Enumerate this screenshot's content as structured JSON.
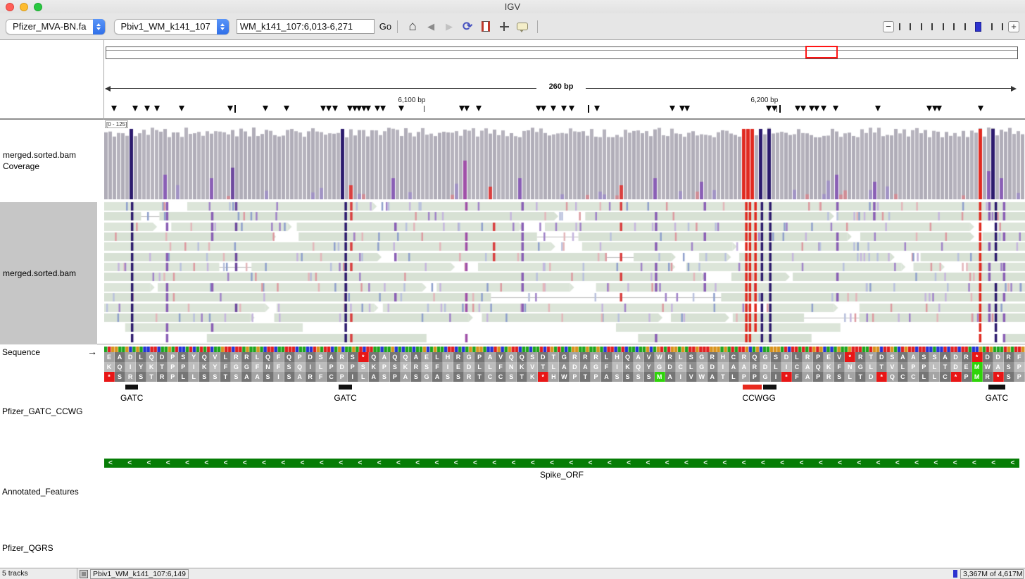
{
  "window": {
    "title": "IGV"
  },
  "toolbar": {
    "genome_select": "Pfizer_MVA-BN.fa",
    "chrom_select": "Pbiv1_WM_k141_107",
    "locus_input": "WM_k141_107:6,013-6,271",
    "go_label": "Go",
    "zoom": {
      "ticks": 10,
      "thumb_index": 7
    }
  },
  "ruler": {
    "span_label": "260 bp",
    "ticks": [
      {
        "label": "6,100 bp",
        "f": 0.334
      },
      {
        "label": "6,200 bp",
        "f": 0.717
      }
    ],
    "roi": {
      "f": 0.766,
      "w": 0.036
    },
    "markers": [
      {
        "f": 0.011
      },
      {
        "f": 0.034
      },
      {
        "f": 0.047
      },
      {
        "f": 0.057
      },
      {
        "f": 0.084
      },
      {
        "f": 0.137
      },
      {
        "f": 0.142,
        "t": "bar"
      },
      {
        "f": 0.175
      },
      {
        "f": 0.198
      },
      {
        "f": 0.238
      },
      {
        "f": 0.244
      },
      {
        "f": 0.251
      },
      {
        "f": 0.267
      },
      {
        "f": 0.272
      },
      {
        "f": 0.277
      },
      {
        "f": 0.282
      },
      {
        "f": 0.287
      },
      {
        "f": 0.297
      },
      {
        "f": 0.303
      },
      {
        "f": 0.323
      },
      {
        "f": 0.388
      },
      {
        "f": 0.394
      },
      {
        "f": 0.407
      },
      {
        "f": 0.472
      },
      {
        "f": 0.477
      },
      {
        "f": 0.488
      },
      {
        "f": 0.499
      },
      {
        "f": 0.508
      },
      {
        "f": 0.526,
        "t": "bar"
      },
      {
        "f": 0.535
      },
      {
        "f": 0.617
      },
      {
        "f": 0.628
      },
      {
        "f": 0.633
      },
      {
        "f": 0.722
      },
      {
        "f": 0.728
      },
      {
        "f": 0.734,
        "t": "bar"
      },
      {
        "f": 0.753
      },
      {
        "f": 0.759
      },
      {
        "f": 0.768
      },
      {
        "f": 0.774
      },
      {
        "f": 0.781
      },
      {
        "f": 0.794
      },
      {
        "f": 0.84
      },
      {
        "f": 0.896
      },
      {
        "f": 0.902
      },
      {
        "f": 0.907
      },
      {
        "f": 0.952
      }
    ]
  },
  "tracks": {
    "coverage": {
      "name": "merged.sorted.bam Coverage",
      "scale_label": "[0 - 125]"
    },
    "alignments": {
      "name": "merged.sorted.bam",
      "rows": 14,
      "big_gaps": [
        {
          "row": 9,
          "f": 0.42,
          "w": 0.25
        },
        {
          "row": 3,
          "f": 0.47,
          "w": 0.045
        },
        {
          "row": 6,
          "f": 0.125,
          "w": 0.035
        },
        {
          "row": 11,
          "f": 0.76,
          "w": 0.06
        },
        {
          "row": 5,
          "f": 0.545,
          "w": 0.03
        },
        {
          "row": 1,
          "f": 0.04,
          "w": 0.02
        }
      ]
    },
    "sequence": {
      "name": "Sequence",
      "strand_arrow": "→",
      "nucleotides": "ATGGAAGCAGACCTTCAAGATCCATCATATCAAGTTCTTAGAAGACTTCAATTTCAACCTGATTCAGCAAGATCTTAACAAGCACAACAAGCAGAACTTCACAGAGGACCTGCAGTTCAACAATCTGATACAGGAAGAAGACTTCATCAACAAGCAGTATGGAGATTGTTTGGGAGATATTGCAGCAAGGGATCTTATATGTGCACAGAAGTTTAATGGCTTGACTGTTCTTCCACCTCTTCTTACCGATGAAATGATTGCC",
      "frames": [
        "EADLQDPSYQVLRRLQFQPDSARS*QAQQAELHRGPAVQQSDTGRRRLHQAVWRLSGRHCRQGSDLRPEV*RTDSAASSADR*DDRF",
        "KQIYKTPPIKYFGGFNFSQILPDPSKPSKRSFIEDLLFNKVTLADAGFIKQYGDCLGDIAARDLICAQKFNGLTVLPPLTDEMWASP",
        "*SRSTRPLLSSTSAASISARFCPILASPASGASSRTCCSTK*HWPTPASSSSMAIVWATLPPGI*FAPRSLTD*QCCLLC*PMR*SP"
      ]
    },
    "gatc": {
      "name": "Pfizer_GATC_CCWG",
      "features": [
        {
          "label": "GATC",
          "f": 0.023,
          "w": 0.014,
          "segments": [
            {
              "color": "#111111",
              "frac": 1
            }
          ]
        },
        {
          "label": "GATC",
          "f": 0.2546,
          "w": 0.0146,
          "segments": [
            {
              "color": "#111111",
              "frac": 1
            }
          ]
        },
        {
          "label": "CCWGG",
          "f": 0.6935,
          "w": 0.0352,
          "segments": [
            {
              "color": "#e82a1e",
              "frac": 0.58
            },
            {
              "color": "#111111",
              "frac": 0.42
            }
          ]
        },
        {
          "label": "GATC",
          "f": 0.9602,
          "w": 0.0183,
          "segments": [
            {
              "color": "#111111",
              "frac": 1
            }
          ]
        }
      ]
    },
    "annotated": {
      "name": "Annotated_Features",
      "feature_label": "Spike_ORF",
      "color": "#067d06",
      "chevron": "<",
      "chevrons": 48
    },
    "qgrs": {
      "name": "Pfizer_QGRS"
    }
  },
  "variant_columns": [
    {
      "f": 0.029,
      "color": "#2d1b6e",
      "cov": "full",
      "density": 0.95
    },
    {
      "f": 0.067,
      "color": "#8a5fb5",
      "cov": 0.35,
      "density": 0.4
    },
    {
      "f": 0.116,
      "color": "#8a5fb5",
      "cov": 0.3,
      "density": 0.35
    },
    {
      "f": 0.142,
      "color": "#6e4a9e",
      "cov": 0.45,
      "density": 0.5
    },
    {
      "f": 0.261,
      "color": "#2d1b6e",
      "cov": "full",
      "density": 0.95
    },
    {
      "f": 0.267,
      "color": "#d94040",
      "cov": 0.2,
      "density": 0.25
    },
    {
      "f": 0.315,
      "color": "#8a5fb5",
      "cov": 0.3,
      "density": 0.35
    },
    {
      "f": 0.392,
      "color": "#a050a8",
      "cov": 0.55,
      "density": 0.6
    },
    {
      "f": 0.422,
      "color": "#d94040",
      "cov": 0.18,
      "density": 0.2
    },
    {
      "f": 0.453,
      "color": "#8a5fb5",
      "cov": 0.3,
      "density": 0.35
    },
    {
      "f": 0.56,
      "color": "#d94040",
      "cov": 0.2,
      "density": 0.25
    },
    {
      "f": 0.598,
      "color": "#8a5fb5",
      "cov": 0.3,
      "density": 0.3
    },
    {
      "f": 0.651,
      "color": "#8a5fb5",
      "cov": 0.25,
      "density": 0.3
    },
    {
      "f": 0.696,
      "color": "#e02a20",
      "cov": "full",
      "density": 0.95
    },
    {
      "f": 0.7,
      "color": "#e02a20",
      "cov": "full",
      "density": 0.95
    },
    {
      "f": 0.706,
      "color": "#e02a20",
      "cov": "full",
      "density": 0.9
    },
    {
      "f": 0.713,
      "color": "#2d1b6e",
      "cov": "full",
      "density": 0.95
    },
    {
      "f": 0.722,
      "color": "#2d1b6e",
      "cov": "full",
      "density": 0.9
    },
    {
      "f": 0.795,
      "color": "#8a5fb5",
      "cov": 0.35,
      "density": 0.4
    },
    {
      "f": 0.835,
      "color": "#8a5fb5",
      "cov": 0.25,
      "density": 0.3
    },
    {
      "f": 0.95,
      "color": "#e02a20",
      "cov": "full",
      "density": 0.9
    },
    {
      "f": 0.96,
      "color": "#8a5fb5",
      "cov": 0.4,
      "density": 0.45
    },
    {
      "f": 0.967,
      "color": "#2d1b6e",
      "cov": "full",
      "density": 0.95
    },
    {
      "f": 0.976,
      "color": "#8a5fb5",
      "cov": 0.3,
      "density": 0.35
    }
  ],
  "statusbar": {
    "tracks_label": "5 tracks",
    "locus": "Pbiv1_WM_k141_107:6,149",
    "memory": "3,367M of 4,617M"
  },
  "colors": {
    "stop": "#e81616",
    "met": "#2fd40a",
    "nt": {
      "A": "#1ea51e",
      "C": "#2433d6",
      "G": "#d8931d",
      "T": "#e02020"
    },
    "coverage_base": "#b4b1bb",
    "read_base": "#dce5d9",
    "read_base_alt": "#d7e1d4",
    "minor_ticks": [
      "#c5b6dd",
      "#e3b6ba",
      "#b9c1dd",
      "#a083c8",
      "#dd9aa0",
      "#8fa0cc"
    ],
    "aa_palettes": [
      [
        "#a4a4a4",
        "#757575"
      ],
      [
        "#bdbdbd",
        "#8e8e8e"
      ],
      [
        "#a4a4a4",
        "#757575"
      ]
    ],
    "accent_blue": "#2f6fe8",
    "annotation_green": "#067d06",
    "roi_red": "#ff1414"
  }
}
